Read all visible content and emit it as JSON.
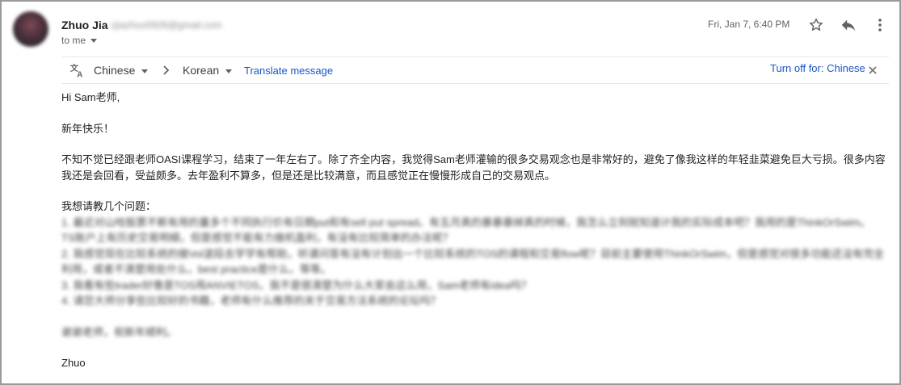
{
  "email": {
    "sender": {
      "name": "Zhuo Jia",
      "email": "zjiazhuo0926@gmail.com"
    },
    "recipient_label": "to me",
    "date": "Fri, Jan 7, 6:40 PM"
  },
  "translate_bar": {
    "source_language": "Chinese",
    "target_language": "Korean",
    "translate_label": "Translate message",
    "turn_off_label": "Turn off for: Chinese"
  },
  "message": {
    "greeting": "Hi Sam老师,",
    "new_year": "新年快乐！",
    "paragraph_1_line_1": "不知不觉已经跟老师OASI课程学习，结束了一年左右了。除了齐全内容，我觉得Sam老师灌输的很多交易观念也是非常好的，避免了像我这样的年轻韭菜避免巨大亏损。很多内容",
    "paragraph_1_line_2": "我还是会回看，受益颇多。去年盈利不算多，但是还是比较满意，而且感觉正在慢慢形成自己的交易观点。",
    "questions_heading": "我想请教几个问题：",
    "blurred_lines": [
      "1. 最近对山哈股票不断有用的量多个不同执行价有日期put和有sell put spread。有五月真的暴暴暴掉真的时候，我怎么立刻就知道计我的实际成本吧？我用的是ThinkOrSwim。",
      "TS账户上有历史交易明细，但是感觉不能有力做机盈利，有没有比较简单的办法呢？",
      "2. 我感觉现在比较系统的做Vol波段去学学有帮助，听课问答有没有计划出一个比较系统的TOS的课程和交易flow呢？目前主要使用ThinkOrSwim，但是感觉对很多功能还没有完全",
      "利用，或者不清楚用处什么，best practice是什么，等等。",
      "3. 我看有些trader好像是TOS用ANVIETOS，我不是很清楚为什么大家会这么用，Sam老师有idea吗？",
      "4. 请您大师分享些比较好的书籍，老师有什么推荐的关于交易方法系统的论坛吗？"
    ],
    "blurred_closing": "谢谢老师，祝新年顺利。",
    "signature": "Zhuo"
  }
}
